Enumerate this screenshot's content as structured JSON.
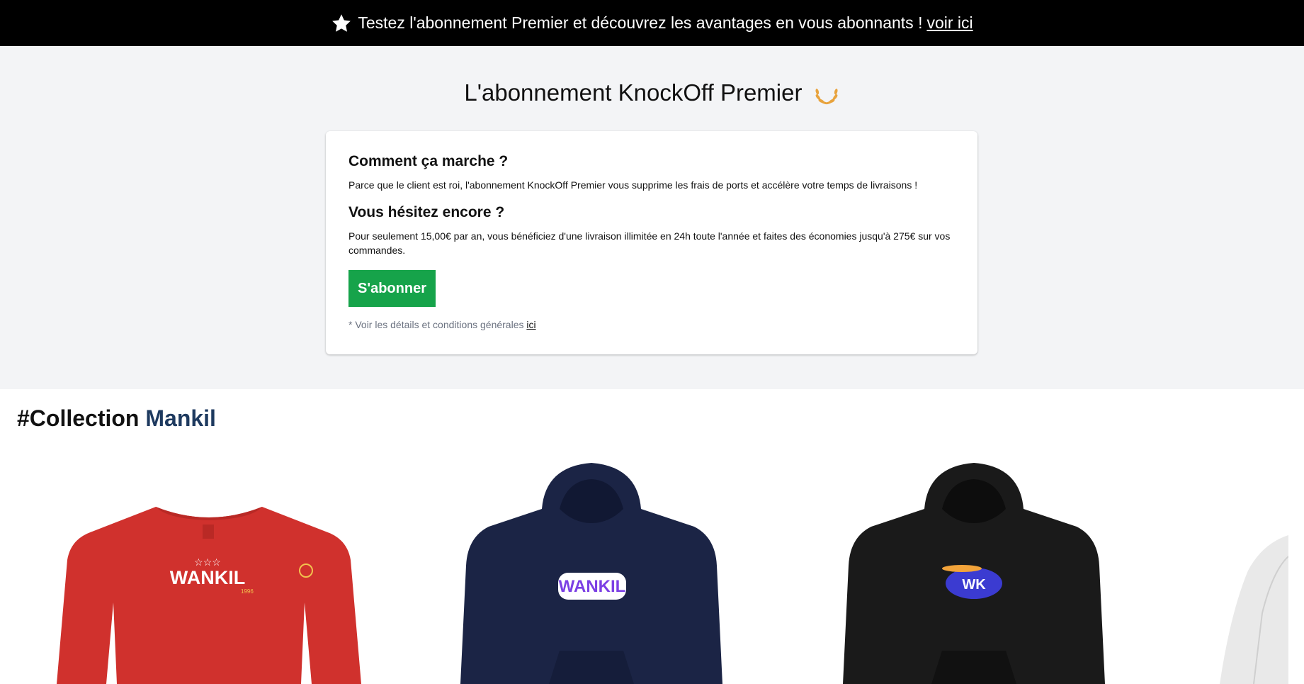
{
  "announcement": {
    "icon": "star-icon",
    "text": "Testez l'abonnement Premier et découvrez les avantages en vous abonnants !",
    "link_label": "voir ici"
  },
  "hero": {
    "title": "L'abonnement KnockOff Premier",
    "title_icon": "laurel-icon",
    "card": {
      "heading1": "Comment ça marche ?",
      "text1": "Parce que le client est roi, l'abonnement KnockOff Premier vous supprime les frais de ports et accélère votre temps de livraisons !",
      "heading2": "Vous hésitez encore ?",
      "text2": "Pour seulement 15,00€ par an, vous bénéficiez d'une livraison illimitée en 24h toute l'année et faites des économies jusqu'à 275€ sur vos commandes.",
      "button_label": "S'abonner",
      "note_prefix": "* Voir les détails et conditions générales",
      "note_link": "ici"
    }
  },
  "collection": {
    "title_prefix": "#Collection",
    "title_accent": "Mankil",
    "products": [
      {
        "name": "red-sweatshirt",
        "color": "#d0312d",
        "logo_text": "WANKIL",
        "stars": "☆☆☆",
        "year": "1996"
      },
      {
        "name": "navy-hoodie",
        "color": "#1b2445",
        "logo_text": "WANKIL"
      },
      {
        "name": "black-hoodie",
        "color": "#1a1a1a",
        "logo_text": "WK"
      },
      {
        "name": "white-hoodie",
        "color": "#e9e9e9"
      }
    ]
  },
  "colors": {
    "button": "#16a34a",
    "accent": "#1e3a5f",
    "hero_bg": "#f3f4f6"
  }
}
